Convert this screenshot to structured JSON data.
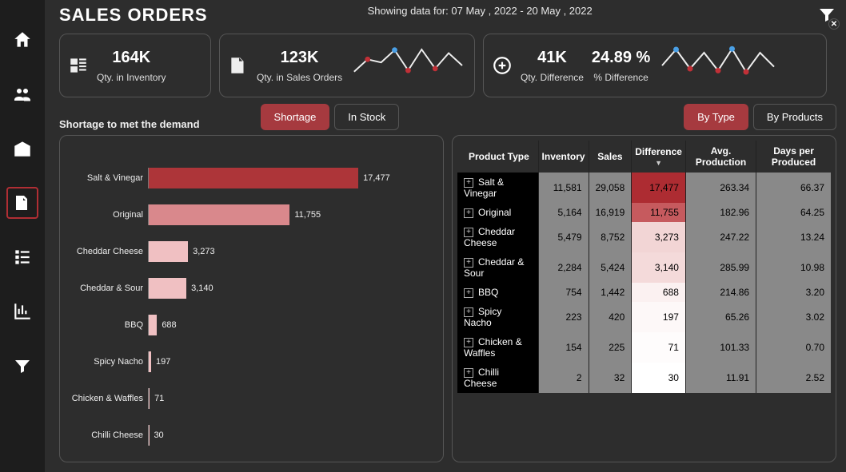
{
  "page_title": "SALES ORDERS",
  "date_text": "Showing data for: 07 May , 2022 - 20 May , 2022",
  "kpi": {
    "inventory": {
      "value": "164K",
      "label": "Qty. in Inventory"
    },
    "sales": {
      "value": "123K",
      "label": "Qty. in Sales Orders"
    },
    "diff": {
      "value": "41K",
      "label": "Qty. Difference"
    },
    "pct": {
      "value": "24.89 %",
      "label": "% Difference"
    }
  },
  "shortage_section_title": "Shortage to met the demand",
  "tabs_left": {
    "shortage": "Shortage",
    "instock": "In Stock"
  },
  "tabs_right": {
    "bytype": "By Type",
    "byproducts": "By Products"
  },
  "table_headers": {
    "product": "Product Type",
    "inventory": "Inventory",
    "sales": "Sales",
    "difference": "Difference",
    "avgprod": "Avg. Production",
    "daysper": "Days per Produced"
  },
  "table_rows": [
    {
      "product": "Salt & Vinegar",
      "inventory": "11,581",
      "sales": "29,058",
      "difference": "17,477",
      "avgprod": "263.34",
      "daysper": "66.37",
      "diff_bg": "#ad2c32",
      "diff_fg": "#000"
    },
    {
      "product": "Original",
      "inventory": "5,164",
      "sales": "16,919",
      "difference": "11,755",
      "avgprod": "182.96",
      "daysper": "64.25",
      "diff_bg": "#c65a5e",
      "diff_fg": "#000"
    },
    {
      "product": "Cheddar Cheese",
      "inventory": "5,479",
      "sales": "8,752",
      "difference": "3,273",
      "avgprod": "247.22",
      "daysper": "13.24",
      "diff_bg": "#f2d5d5",
      "diff_fg": "#000"
    },
    {
      "product": "Cheddar & Sour",
      "inventory": "2,284",
      "sales": "5,424",
      "difference": "3,140",
      "avgprod": "285.99",
      "daysper": "10.98",
      "diff_bg": "#f4dada",
      "diff_fg": "#000"
    },
    {
      "product": "BBQ",
      "inventory": "754",
      "sales": "1,442",
      "difference": "688",
      "avgprod": "214.86",
      "daysper": "3.20",
      "diff_bg": "#fbf1f1",
      "diff_fg": "#000"
    },
    {
      "product": "Spicy Nacho",
      "inventory": "223",
      "sales": "420",
      "difference": "197",
      "avgprod": "65.26",
      "daysper": "3.02",
      "diff_bg": "#fdf8f8",
      "diff_fg": "#000"
    },
    {
      "product": "Chicken & Waffles",
      "inventory": "154",
      "sales": "225",
      "difference": "71",
      "avgprod": "101.33",
      "daysper": "0.70",
      "diff_bg": "#fefcfc",
      "diff_fg": "#000"
    },
    {
      "product": "Chilli Cheese",
      "inventory": "2",
      "sales": "32",
      "difference": "30",
      "avgprod": "11.91",
      "daysper": "2.52",
      "diff_bg": "#ffffff",
      "diff_fg": "#000"
    }
  ],
  "chart_data": {
    "type": "bar",
    "title": "Shortage to met the demand",
    "xlabel": "",
    "ylabel": "",
    "categories": [
      "Salt & Vinegar",
      "Original",
      "Cheddar Cheese",
      "Cheddar & Sour",
      "BBQ",
      "Spicy Nacho",
      "Chicken & Waffles",
      "Chilli Cheese"
    ],
    "values": [
      17477,
      11755,
      3273,
      3140,
      688,
      197,
      71,
      30
    ],
    "colors": [
      "#ad3539",
      "#d9888c",
      "#f0c0c2",
      "#f0c0c2",
      "#f0c0c2",
      "#f0c0c2",
      "#f0c0c2",
      "#f0c0c2"
    ],
    "xmax": 18000
  },
  "sparklines": {
    "sales": {
      "points": [
        20,
        40,
        35,
        55,
        22,
        56,
        25,
        50,
        30
      ],
      "dots": [
        [
          1,
          40,
          "#c13037"
        ],
        [
          4,
          22,
          "#c13037"
        ],
        [
          6,
          25,
          "#c13037"
        ],
        [
          3,
          55,
          "#4aa0e6"
        ]
      ]
    },
    "diff": {
      "points": [
        30,
        55,
        25,
        50,
        22,
        56,
        20,
        50,
        28
      ],
      "dots": [
        [
          2,
          25,
          "#c13037"
        ],
        [
          4,
          22,
          "#c13037"
        ],
        [
          6,
          20,
          "#c13037"
        ],
        [
          1,
          55,
          "#4aa0e6"
        ],
        [
          5,
          56,
          "#4aa0e6"
        ]
      ]
    }
  }
}
